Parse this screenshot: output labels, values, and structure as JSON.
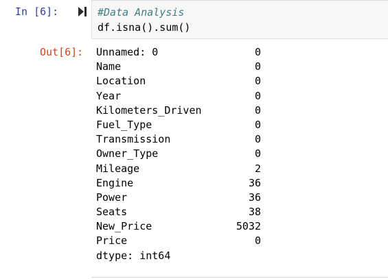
{
  "cell": {
    "in_prompt": "In [6]:",
    "comment": "#Data Analysis",
    "code": "df.isna().sum()",
    "out_prompt": "Out[6]:"
  },
  "output": {
    "rows": [
      {
        "key": "Unnamed: 0",
        "value": "0"
      },
      {
        "key": "Name",
        "value": "0"
      },
      {
        "key": "Location",
        "value": "0"
      },
      {
        "key": "Year",
        "value": "0"
      },
      {
        "key": "Kilometers_Driven",
        "value": "0"
      },
      {
        "key": "Fuel_Type",
        "value": "0"
      },
      {
        "key": "Transmission",
        "value": "0"
      },
      {
        "key": "Owner_Type",
        "value": "0"
      },
      {
        "key": "Mileage",
        "value": "2"
      },
      {
        "key": "Engine",
        "value": "36"
      },
      {
        "key": "Power",
        "value": "36"
      },
      {
        "key": "Seats",
        "value": "38"
      },
      {
        "key": "New_Price",
        "value": "5032"
      },
      {
        "key": "Price",
        "value": "0"
      }
    ],
    "dtype": "dtype: int64"
  },
  "icons": {
    "run": "run-cell-icon"
  },
  "colors": {
    "in_prompt": "#303F9F",
    "out_prompt": "#D84315",
    "comment": "#408080",
    "input_bg": "#f7f7f7"
  }
}
